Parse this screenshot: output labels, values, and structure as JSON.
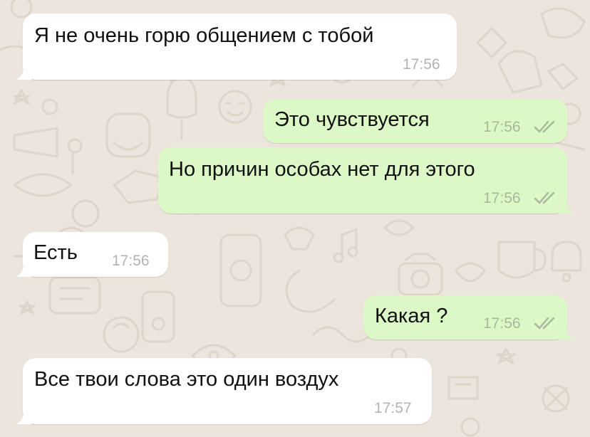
{
  "colors": {
    "wallpaper": "#ece5dd",
    "incoming_bubble": "#ffffff",
    "outgoing_bubble": "#dcf8c6",
    "timestamp_incoming": "#b3b3b3",
    "timestamp_outgoing": "#a9b89c",
    "read_ticks": "#a9b89c"
  },
  "icons": {
    "wallpaper": "doodle-pattern",
    "status": "double-check-icon"
  },
  "messages": [
    {
      "direction": "incoming",
      "text": "Я не очень горю общением с тобой",
      "time": "17:56"
    },
    {
      "direction": "outgoing",
      "text": "Это чувствуется",
      "time": "17:56",
      "status": "delivered"
    },
    {
      "direction": "outgoing",
      "text": "Но причин особах нет для этого",
      "time": "17:56",
      "status": "delivered"
    },
    {
      "direction": "incoming",
      "text": "Есть",
      "time": "17:56"
    },
    {
      "direction": "outgoing",
      "text": "Какая ?",
      "time": "17:56",
      "status": "delivered"
    },
    {
      "direction": "incoming",
      "text": "Все твои слова это один воздух",
      "time": "17:57"
    }
  ]
}
